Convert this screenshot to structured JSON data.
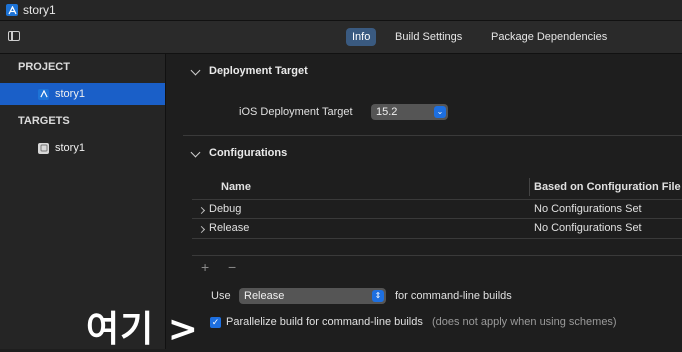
{
  "window": {
    "title": "story1"
  },
  "tabs": [
    {
      "label": "Info",
      "active": true
    },
    {
      "label": "Build Settings",
      "active": false
    },
    {
      "label": "Package Dependencies",
      "active": false
    }
  ],
  "sidebar": {
    "project_header": "PROJECT",
    "project_item": "story1",
    "targets_header": "TARGETS",
    "target_item": "story1"
  },
  "deployment": {
    "section_title": "Deployment Target",
    "ios_label": "iOS Deployment Target",
    "ios_value": "15.2"
  },
  "configurations": {
    "section_title": "Configurations",
    "columns": [
      "Name",
      "Based on Configuration File"
    ],
    "rows": [
      {
        "name": "Debug",
        "file": "No Configurations Set"
      },
      {
        "name": "Release",
        "file": "No Configurations Set"
      }
    ],
    "add_symbol": "+",
    "remove_symbol": "−",
    "use_label": "Use",
    "use_value": "Release",
    "use_suffix": "for command-line builds",
    "parallelize_label": "Parallelize build for command-line builds",
    "parallelize_hint": "(does not apply when using schemes)",
    "parallelize_checked": true
  },
  "annotation": {
    "text": "여기 >"
  },
  "colors": {
    "accent": "#1d6fe0",
    "selection": "#1a5fc8",
    "active_tab": "#3a5a80"
  }
}
